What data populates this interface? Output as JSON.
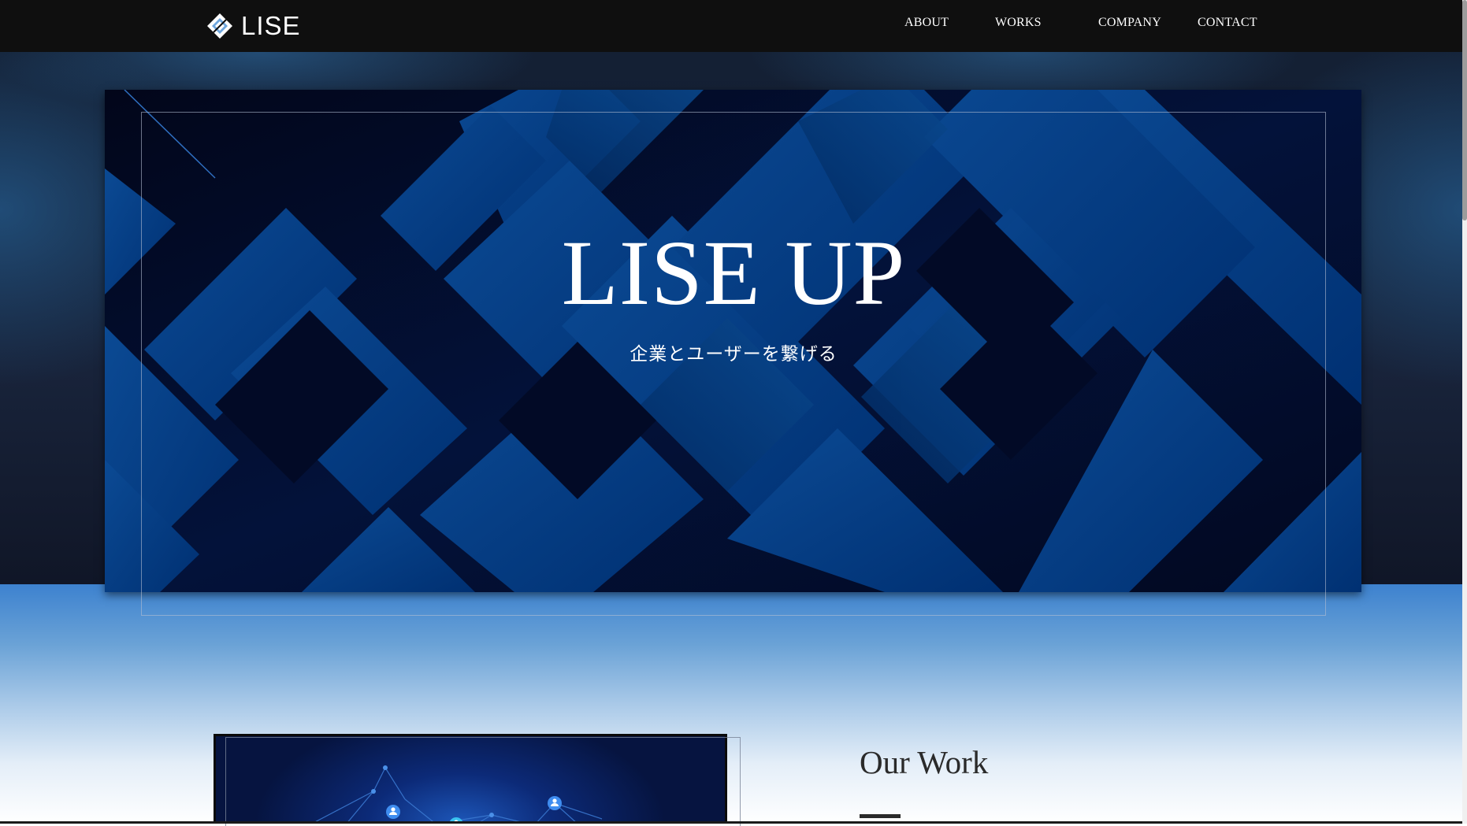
{
  "header": {
    "logo_text": "LISE",
    "nav": [
      "ABOUT",
      "WORKS",
      "COMPANY",
      "CONTACT"
    ]
  },
  "hero": {
    "title": "LISE UP",
    "subtitle": "企業とユーザーを繋げる"
  },
  "work_section": {
    "title": "Our Work"
  },
  "colors": {
    "header_bg": "#0f0f0f",
    "hero_dark": "#02081f",
    "hero_blue": "#003b7a",
    "section_gradient_top": "#3d82cf"
  },
  "icons": [
    "logo-diamond-icon",
    "user-node-icon"
  ]
}
